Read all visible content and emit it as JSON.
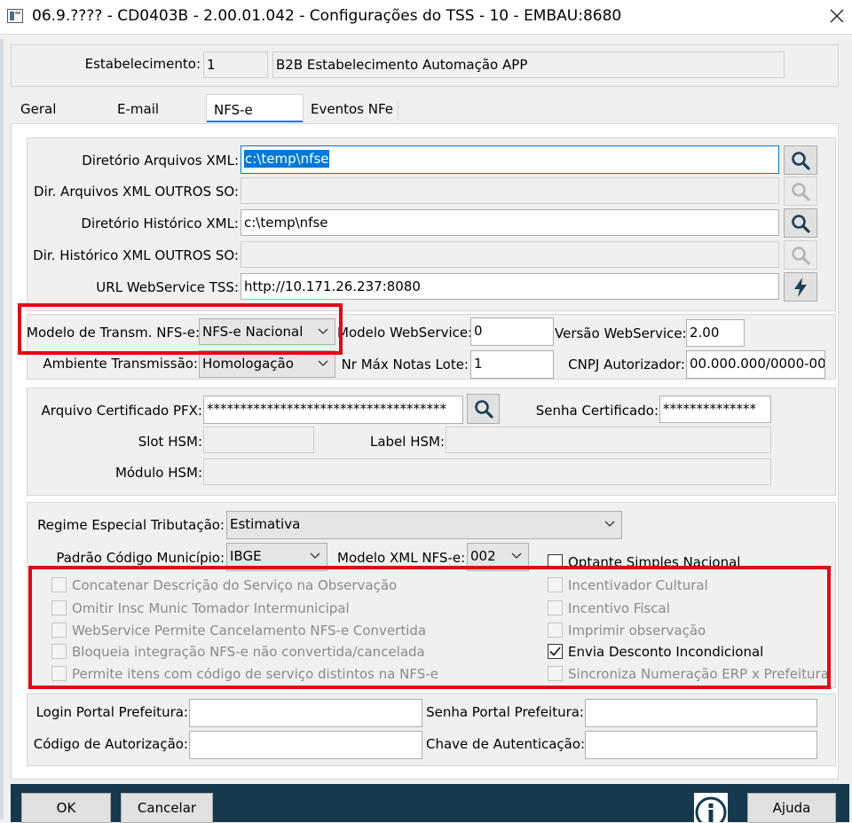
{
  "window": {
    "title": "06.9.???? - CD0403B - 2.00.01.042 - Configurações do TSS - 10 - EMBAU:8680"
  },
  "header": {
    "estabelecimento_label": "Estabelecimento:",
    "estabelecimento_code": "1",
    "estabelecimento_name": "B2B  Estabelecimento Automação APP"
  },
  "tabs": [
    {
      "label": "Geral"
    },
    {
      "label": "E-mail"
    },
    {
      "label": "NFS-e",
      "active": true
    },
    {
      "label": "Eventos NFe"
    }
  ],
  "paths": {
    "dir_xml_label": "Diretório Arquivos XML:",
    "dir_xml_value": "c:\\temp\\nfse",
    "dir_xml_outros_label": "Dir. Arquivos XML OUTROS SO:",
    "dir_xml_outros_value": "",
    "dir_hist_label": "Diretório Histórico XML:",
    "dir_hist_value": "c:\\temp\\nfse",
    "dir_hist_outros_label": "Dir. Histórico XML OUTROS SO:",
    "dir_hist_outros_value": "",
    "url_label": "URL WebService TSS:",
    "url_value": "http://10.171.26.237:8080"
  },
  "transmission": {
    "modelo_transm_label": "Modelo de Transm. NFS-e:",
    "modelo_transm_value": "NFS-e Nacional",
    "modelo_ws_label": "Modelo WebService:",
    "modelo_ws_value": "0",
    "versao_ws_label": "Versão WebService:",
    "versao_ws_value": "2.00",
    "ambiente_label": "Ambiente Transmissão:",
    "ambiente_value": "Homologação",
    "nr_max_label": "Nr Máx Notas Lote:",
    "nr_max_value": "1",
    "cnpj_label": "CNPJ Autorizador:",
    "cnpj_value": "00.000.000/0000-00"
  },
  "certificate": {
    "arquivo_label": "Arquivo Certificado PFX:",
    "arquivo_value": "************************************",
    "senha_label": "Senha Certificado:",
    "senha_value": "**************",
    "slot_label": "Slot HSM:",
    "slot_value": "",
    "label_hsm_label": "Label HSM:",
    "label_hsm_value": "",
    "modulo_label": "Módulo HSM:",
    "modulo_value": ""
  },
  "options": {
    "regime_label": "Regime Especial Tributação:",
    "regime_value": "Estimativa",
    "padrao_label": "Padrão Código Município:",
    "padrao_value": "IBGE",
    "modelo_xml_label": "Modelo XML NFS-e:",
    "modelo_xml_value": "002",
    "optante_label": "Optante Simples Nacional",
    "checks_left": [
      {
        "label": "Concatenar Descrição do Serviço na Observação",
        "checked": false,
        "enabled": false
      },
      {
        "label": "Omitir Insc Munic Tomador Intermunicipal",
        "checked": false,
        "enabled": false
      },
      {
        "label": "WebService Permite Cancelamento NFS-e Convertida",
        "checked": false,
        "enabled": false
      },
      {
        "label": "Bloqueia integração NFS-e não convertida/cancelada",
        "checked": false,
        "enabled": false
      },
      {
        "label": "Permite itens com código de serviço distintos na NFS-e",
        "checked": false,
        "enabled": false
      }
    ],
    "checks_right": [
      {
        "label": "Incentivador Cultural",
        "checked": false,
        "enabled": false
      },
      {
        "label": "Incentivo Fiscal",
        "checked": false,
        "enabled": false
      },
      {
        "label": "Imprimir observação",
        "checked": false,
        "enabled": false
      },
      {
        "label": "Envia Desconto Incondicional",
        "checked": true,
        "enabled": true
      },
      {
        "label": "Sincroniza Numeração ERP x Prefeitura",
        "checked": false,
        "enabled": false
      }
    ]
  },
  "portal": {
    "login_label": "Login Portal Prefeitura:",
    "login_value": "",
    "senha_label": "Senha Portal Prefeitura:",
    "senha_value": "",
    "codigo_label": "Código de Autorização:",
    "codigo_value": "",
    "chave_label": "Chave de Autenticação:",
    "chave_value": ""
  },
  "footer": {
    "ok": "OK",
    "cancelar": "Cancelar",
    "ajuda": "Ajuda"
  },
  "colors": {
    "highlight": "#e30613",
    "footer_bg": "#17394d",
    "accent": "#0078d7"
  }
}
